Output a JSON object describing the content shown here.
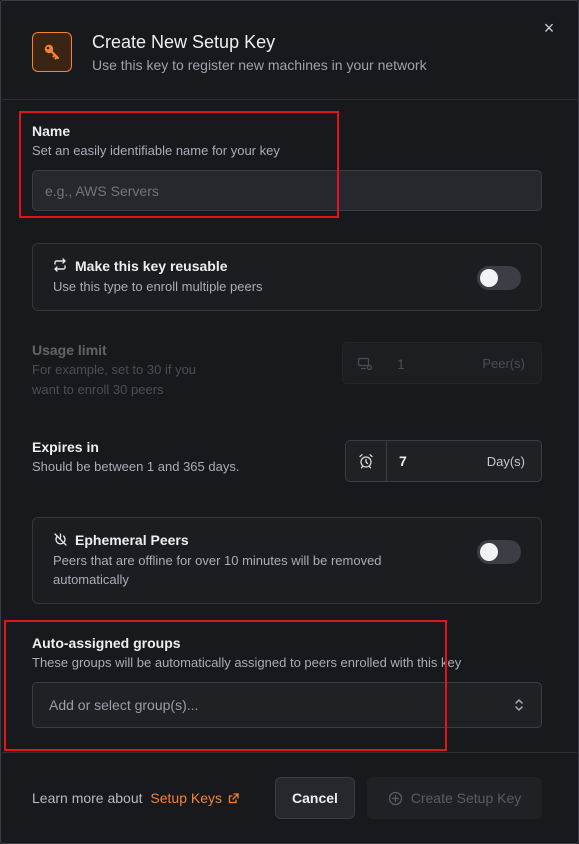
{
  "dialog": {
    "title": "Create New Setup Key",
    "subtitle": "Use this key to register new machines in your network",
    "close_label": "×"
  },
  "name_field": {
    "label": "Name",
    "help": "Set an easily identifiable name for your key",
    "placeholder": "e.g., AWS Servers",
    "value": ""
  },
  "reusable": {
    "title": "Make this key reusable",
    "help": "Use this type to enroll multiple peers",
    "enabled": false
  },
  "usage_limit": {
    "label": "Usage limit",
    "help_line1": "For example, set to 30 if you",
    "help_line2": "want to enroll 30 peers",
    "value": "1",
    "unit": "Peer(s)"
  },
  "expires": {
    "label": "Expires in",
    "help": "Should be between 1 and 365 days.",
    "value": "7",
    "unit": "Day(s)"
  },
  "ephemeral": {
    "title": "Ephemeral Peers",
    "help_line1": "Peers that are offline for over 10 minutes will be removed",
    "help_line2": "automatically",
    "enabled": false
  },
  "groups": {
    "label": "Auto-assigned groups",
    "help": "These groups will be automatically assigned to peers enrolled with this key",
    "placeholder": "Add or select group(s)..."
  },
  "footer": {
    "learn_more": "Learn more about",
    "link_text": "Setup Keys",
    "cancel_label": "Cancel",
    "create_label": "Create Setup Key"
  },
  "colors": {
    "accent": "#f68330",
    "highlight": "#e0141a",
    "background": "#18191d"
  }
}
